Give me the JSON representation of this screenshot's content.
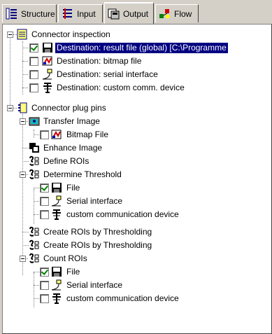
{
  "tabs": [
    {
      "label": "Structure",
      "icon": "structure-icon"
    },
    {
      "label": "Input",
      "icon": "input-icon"
    },
    {
      "label": "Output",
      "icon": "output-icon",
      "active": true
    },
    {
      "label": "Flow",
      "icon": "flow-icon"
    }
  ],
  "tree": {
    "connector_inspection": "Connector inspection",
    "dest_file": "Destination: result file (global) [C:\\Programme",
    "dest_bitmap": "Destination: bitmap file",
    "dest_serial": "Destination: serial interface",
    "dest_custom": "Destination: custom comm. device",
    "plug_pins": "Connector plug pins",
    "transfer_image": "Transfer Image",
    "bitmap_file": "Bitmap File",
    "enhance_image": "Enhance Image",
    "define_rois": "Define ROIs",
    "determine_threshold": "Determine Threshold",
    "file": "File",
    "serial": "Serial interface",
    "custom": "custom communication device",
    "create_rois": "Create ROIs by Thresholding",
    "count_rois": "Count ROIs"
  },
  "checked": {
    "dest_file": true,
    "dest_bitmap": false,
    "dest_serial": false,
    "dest_custom": false,
    "bitmap_file": false,
    "dt_file": true,
    "dt_serial": false,
    "dt_custom": false,
    "cr_file": true,
    "cr_serial": false,
    "cr_custom": false
  },
  "colors": {
    "selection": "#000080",
    "check": "#008000",
    "face": "#d4d0c8"
  }
}
